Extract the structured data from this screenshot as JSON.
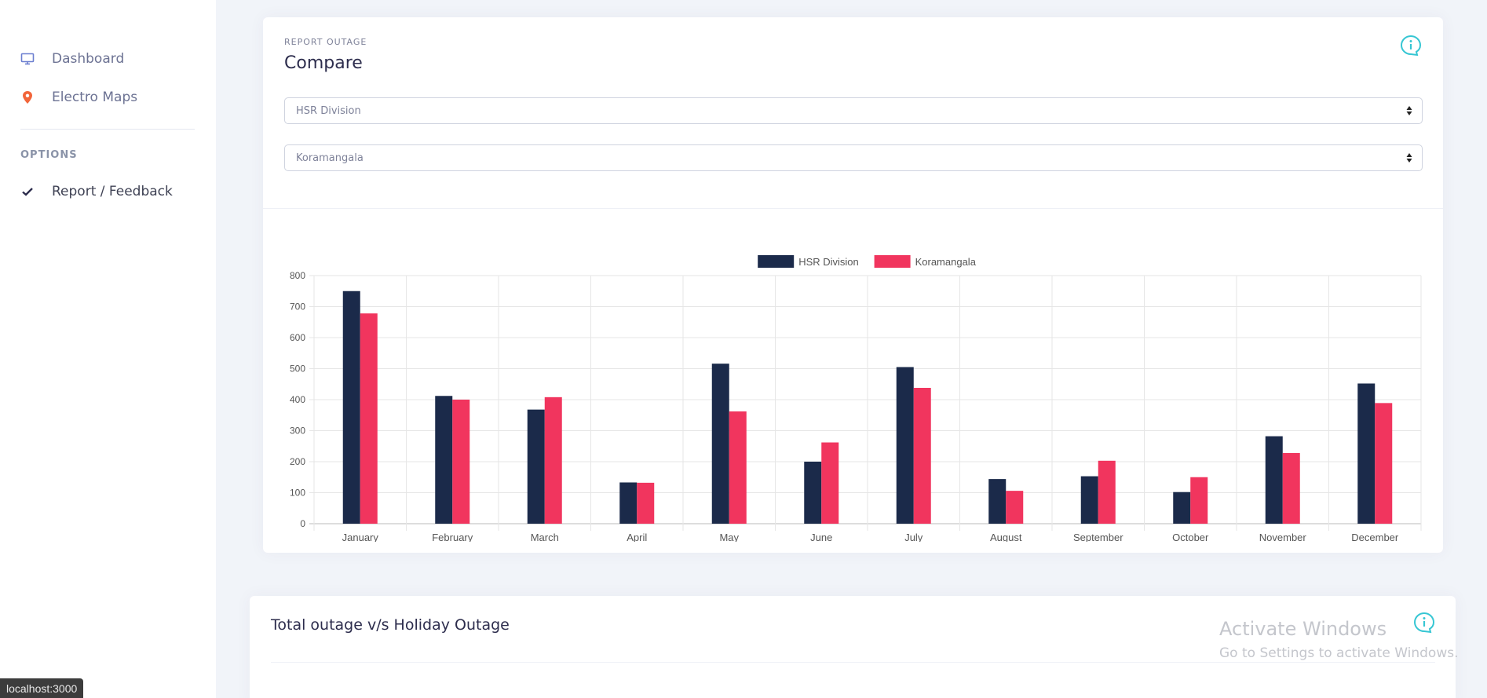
{
  "sidebar": {
    "items": [
      {
        "label": "Dashboard",
        "icon": "monitor-icon"
      },
      {
        "label": "Electro Maps",
        "icon": "map-pin-icon"
      }
    ],
    "section_title": "OPTIONS",
    "options": [
      {
        "label": "Report / Feedback",
        "icon": "check-icon"
      }
    ]
  },
  "compare_card": {
    "eyebrow": "REPORT OUTAGE",
    "title": "Compare",
    "select_1": "HSR Division",
    "select_2": "Koramangala"
  },
  "outage_card": {
    "title": "Total outage v/s Holiday Outage"
  },
  "watermark": {
    "line1": "Activate Windows",
    "line2": "Go to Settings to activate Windows."
  },
  "status_url": "localhost:3000",
  "colors": {
    "series1": "#1b2a4a",
    "series2": "#f1355e",
    "accent": "#36c6d3",
    "pin": "#f2653a"
  },
  "chart_data": {
    "type": "bar",
    "categories": [
      "January",
      "February",
      "March",
      "April",
      "May",
      "June",
      "July",
      "August",
      "September",
      "October",
      "November",
      "December"
    ],
    "series": [
      {
        "name": "HSR Division",
        "values": [
          750,
          412,
          368,
          133,
          516,
          200,
          505,
          144,
          153,
          102,
          282,
          452
        ]
      },
      {
        "name": "Koramangala",
        "values": [
          678,
          400,
          408,
          132,
          362,
          262,
          438,
          106,
          203,
          150,
          228,
          389
        ]
      }
    ],
    "ylim": [
      0,
      800
    ],
    "yticks": [
      0,
      100,
      200,
      300,
      400,
      500,
      600,
      700,
      800
    ],
    "legend": "top-center",
    "grid": true
  }
}
